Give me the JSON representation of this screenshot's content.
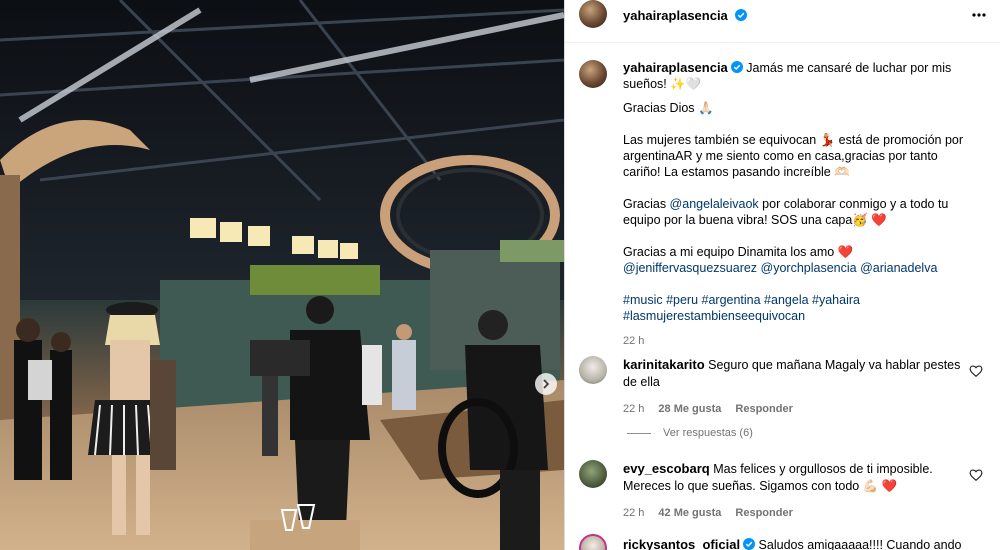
{
  "post": {
    "username": "yahairaplasencia",
    "caption": {
      "line1": "Jamás me cansaré de luchar por mis sueños! ✨🤍",
      "p2": "Gracias Dios 🙏🏻",
      "p3": "Las mujeres también se equivocan 💃🏼 está de promoción por argentinaAR y me siento como en casa,gracias por tanto cariño! La estamos pasando increíble 🫶🏻",
      "p4_pre": "Gracias ",
      "p4_mention": "@angelaleivaok",
      "p4_post": " por colaborar conmigo y a todo tu equipo por la buena vibra! SOS una capa🥳 ❤️",
      "p5": "Gracias a mi equipo Dinamita los amo ❤️",
      "p5_mentions": "@jeniffervasquezsuarez @yorchplasencia @arianadelva",
      "hashtags_line1": "#music #peru #argentina #angela #yahaira",
      "hashtags_line2": "#lasmujerestambienseequivocan"
    },
    "time": "22 h"
  },
  "comments": [
    {
      "username": "karinitakarito",
      "text": "Seguro que mañana Magaly va hablar pestes de ella",
      "time": "22 h",
      "likes": "28 Me gusta",
      "reply": "Responder",
      "view_replies": "Ver respuestas (6)"
    },
    {
      "username": "evy_escobarq",
      "text": "Mas felices y orgullosos de ti imposible. Mereces lo que sueñas. Sigamos con todo 💪🏻 ❤️",
      "time": "22 h",
      "likes": "42 Me gusta",
      "reply": "Responder"
    },
    {
      "username": "rickysantos_oficial",
      "text": "Saludos amigaaaaa!!!! Cuando ando en"
    }
  ],
  "colors": {
    "verified": "#0095f6",
    "link": "#00376b",
    "muted": "#737373"
  },
  "icons": [
    "verified-icon",
    "more-options-icon",
    "heart-icon",
    "chevron-right-icon"
  ]
}
